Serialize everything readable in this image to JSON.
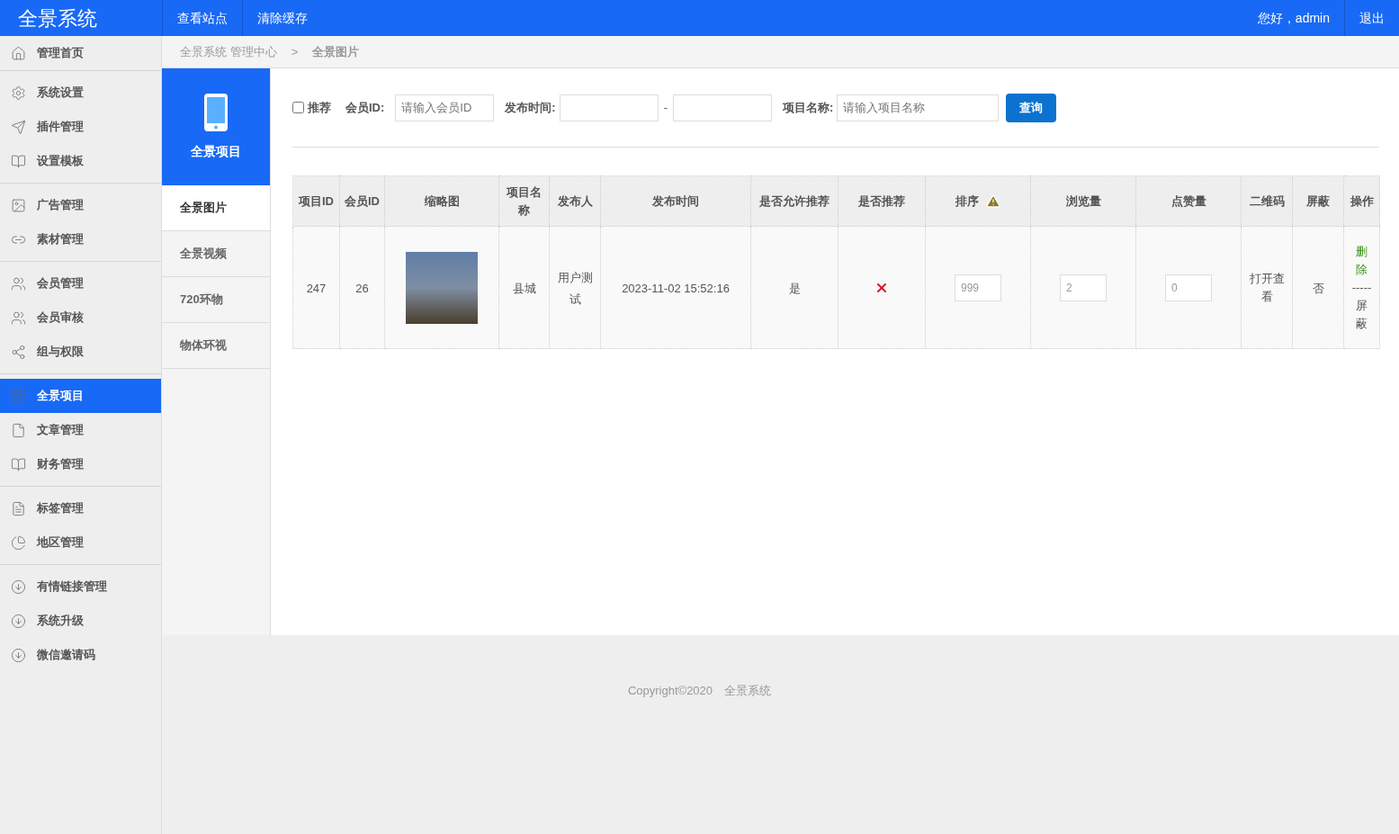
{
  "header": {
    "logo": "全景系统",
    "nav": [
      "查看站点",
      "清除缓存"
    ],
    "greeting": "您好，admin",
    "logout": "退出"
  },
  "sidebar": [
    {
      "items": [
        {
          "label": "管理首页",
          "selected": false
        }
      ]
    },
    {
      "items": [
        {
          "label": "系统设置",
          "selected": false
        },
        {
          "label": "插件管理",
          "selected": false
        },
        {
          "label": "设置模板",
          "selected": false
        }
      ]
    },
    {
      "items": [
        {
          "label": "广告管理",
          "selected": false
        },
        {
          "label": "素材管理",
          "selected": false
        }
      ]
    },
    {
      "items": [
        {
          "label": "会员管理",
          "selected": false
        },
        {
          "label": "会员审核",
          "selected": false
        },
        {
          "label": "组与权限",
          "selected": false
        }
      ]
    },
    {
      "items": [
        {
          "label": "全景项目",
          "selected": true
        },
        {
          "label": "文章管理",
          "selected": false
        },
        {
          "label": "财务管理",
          "selected": false
        }
      ]
    },
    {
      "items": [
        {
          "label": "标签管理",
          "selected": false
        },
        {
          "label": "地区管理",
          "selected": false
        }
      ]
    },
    {
      "items": [
        {
          "label": "有情链接管理",
          "selected": false
        },
        {
          "label": "系统升级",
          "selected": false
        },
        {
          "label": "微信邀请码",
          "selected": false
        }
      ]
    }
  ],
  "breadcrumb": {
    "items": [
      "全景系统 管理中心",
      "全景图片"
    ],
    "separator": ">"
  },
  "submenu": {
    "title": "全景项目",
    "items": [
      {
        "label": "全景图片",
        "selected": true
      },
      {
        "label": "全景视频",
        "selected": false
      },
      {
        "label": "720环物",
        "selected": false
      },
      {
        "label": "物体环视",
        "selected": false
      }
    ]
  },
  "filters": {
    "recommend": {
      "label": "推荐",
      "checked": false
    },
    "member_id": {
      "label": "会员ID:",
      "placeholder": "请输入会员ID"
    },
    "publish_time": {
      "label": "发布时间:",
      "separator": "-"
    },
    "project_name": {
      "label": "项目名称:",
      "placeholder": "请输入项目名称"
    },
    "query": "查询"
  },
  "table": {
    "columns": [
      {
        "label": "项目ID",
        "warning": false
      },
      {
        "label": "会员ID",
        "warning": false
      },
      {
        "label": "缩略图",
        "warning": false
      },
      {
        "label": "项目名称",
        "warning": false
      },
      {
        "label": "发布人",
        "warning": false
      },
      {
        "label": "发布时间",
        "warning": false
      },
      {
        "label": "是否允许推荐",
        "warning": false
      },
      {
        "label": "是否推荐",
        "warning": false
      },
      {
        "label": "排序",
        "warning": true
      },
      {
        "label": "浏览量",
        "warning": false
      },
      {
        "label": "点赞量",
        "warning": false
      },
      {
        "label": "二维码",
        "warning": false
      },
      {
        "label": "屏蔽",
        "warning": false
      },
      {
        "label": "操作",
        "warning": false
      }
    ],
    "rows": [
      {
        "cells": [
          {
            "kind": "text",
            "text": "247"
          },
          {
            "kind": "text",
            "text": "26"
          },
          {
            "kind": "image"
          },
          {
            "kind": "text",
            "text": "县城"
          },
          {
            "kind": "text",
            "text": "用户测试"
          },
          {
            "kind": "text",
            "text": "2023-11-02 15:52:16"
          },
          {
            "kind": "text",
            "text": "是"
          },
          {
            "kind": "cross"
          },
          {
            "kind": "input",
            "value": "999"
          },
          {
            "kind": "input",
            "value": "2"
          },
          {
            "kind": "input",
            "value": "0"
          },
          {
            "kind": "link",
            "text": "打开查看"
          },
          {
            "kind": "text",
            "text": "否"
          },
          {
            "kind": "actions",
            "delete": "删除",
            "separator": "-----",
            "block": "屏蔽"
          }
        ]
      }
    ]
  },
  "footer": "Copyright©2020　全景系统"
}
